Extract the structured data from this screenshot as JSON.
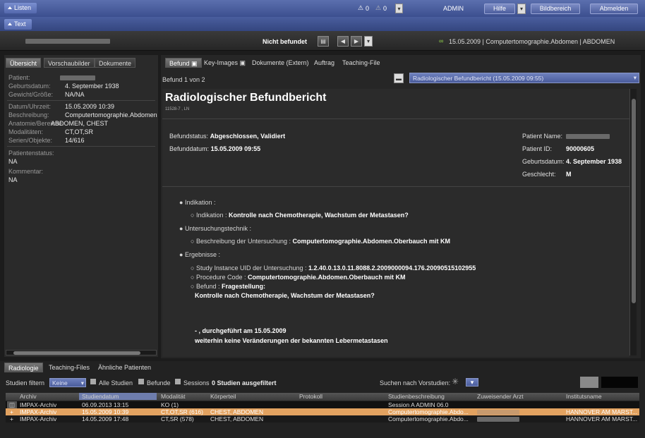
{
  "topbar": {
    "listen_tab": "Listen",
    "alert1": "0",
    "alert2": "0",
    "user": "ADMIN",
    "help": "Hilfe",
    "image_area": "Bildbereich",
    "logout": "Abmelden"
  },
  "textbar": {
    "tab": "Text"
  },
  "statusbar": {
    "state": "Nicht befundet",
    "study_info": "15.05.2009 | Computertomographie.Abdomen | ABDOMEN"
  },
  "left": {
    "tabs": [
      "Übersicht",
      "Vorschaubilder",
      "Dokumente"
    ],
    "fields": [
      {
        "label": "Patient:",
        "value": ""
      },
      {
        "label": "Geburtsdatum:",
        "value": "4. September 1938"
      },
      {
        "label": "Gewicht/Größe:",
        "value": "NA/NA"
      },
      {
        "label": "Datum/Uhrzeit:",
        "value": "15.05.2009 10:39"
      },
      {
        "label": "Beschreibung:",
        "value": "Computertomographie.Abdomen"
      },
      {
        "label": "Anatomie/Bereiche:",
        "value": "ABDOMEN, CHEST"
      },
      {
        "label": "Modalitäten:",
        "value": "CT,OT,SR"
      },
      {
        "label": "Serien/Objekte:",
        "value": "14/616"
      }
    ],
    "status_label": "Patientenstatus:",
    "status_value": "NA",
    "comment_label": "Kommentar:",
    "comment_value": "NA"
  },
  "right": {
    "tabs": [
      "Befund",
      "Key-Images",
      "Dokumente (Extern)",
      "Auftrag",
      "Teaching-File"
    ],
    "pager": "Befund 1 von 2",
    "report_select": "Radiologischer Befundbericht (15.05.2009 09:55)"
  },
  "report": {
    "title": "Radiologischer Befundbericht",
    "code": "11528-7 , LN",
    "status_label": "Befundstatus:",
    "status_value": "Abgeschlossen, Validiert",
    "date_label": "Befunddatum:",
    "date_value": "15.05.2009 09:55",
    "pname_label": "Patient Name:",
    "pid_label": "Patient ID:",
    "pid_value": "90000605",
    "dob_label": "Geburtsdatum:",
    "dob_value": "4. September 1938",
    "sex_label": "Geschlecht:",
    "sex_value": "M",
    "s1": "Indikation :",
    "s1a_label": "Indikation :",
    "s1a_value": "Kontrolle nach Chemotherapie, Wachstum der Metastasen?",
    "s2": "Untersuchungstechnik :",
    "s2a_label": "Beschreibung der Untersuchung :",
    "s2a_value": "Computertomographie.Abdomen.Oberbauch mit KM",
    "s3": "Ergebnisse :",
    "s3a_label": "Study Instance UID der Untersuchung :",
    "s3a_value": "1.2.40.0.13.0.11.8088.2.2009000094.176.20090515102955",
    "s3b_label": "Procedure Code :",
    "s3b_value": "Computertomographie.Abdomen.Oberbauch mit KM",
    "s3c_label": "Befund :",
    "s3c_value": "Fragestellung:",
    "s3c_line2": "Kontrolle nach Chemotherapie, Wachstum der Metastasen?",
    "s4_line1": "- , durchgeführt am 15.05.2009",
    "s4_line2": "weiterhin keine Veränderungen der bekannten Lebermetastasen"
  },
  "bottom": {
    "tabs": [
      "Radiologie",
      "Teaching-Files",
      "Ähnliche Patienten"
    ],
    "filter_label": "Studien filtern",
    "filter_value": "Keine",
    "cb1": "Alle Studien",
    "cb2": "Befunde",
    "cb3": "Sessions",
    "filtered": "0 Studien ausgefiltert",
    "search_prior": "Suchen nach Vorstudien:",
    "columns": [
      "Archiv",
      "Studiendatum",
      "Modalität",
      "Körperteil",
      "Protokoll",
      "Studienbeschreibung",
      "Zuweisender Arzt",
      "Institutsname"
    ],
    "rows": [
      [
        "IMPAX-Archiv",
        "06.09.2013 13:15",
        "KO (1)",
        "",
        "",
        "Session    A  ADMIN 06.0",
        "",
        ""
      ],
      [
        "IMPAX-Archiv",
        "15.05.2009 10:39",
        "CT,OT,SR (616)",
        "CHEST, ABDOMEN",
        "",
        "Computertomographie.Abdo...",
        "",
        "HANNOVER AM MARST..."
      ],
      [
        "IMPAX-Archiv",
        "14.05.2009 17:48",
        "CT,SR (578)",
        "CHEST, ABDOMEN",
        "",
        "Computertomographie.Abdo...",
        "",
        "HANNOVER AM MARST..."
      ]
    ]
  },
  "colors": {
    "accent": "#4a5e9e",
    "highlight_row": "#e2a260",
    "background": "#1c1c1c"
  }
}
